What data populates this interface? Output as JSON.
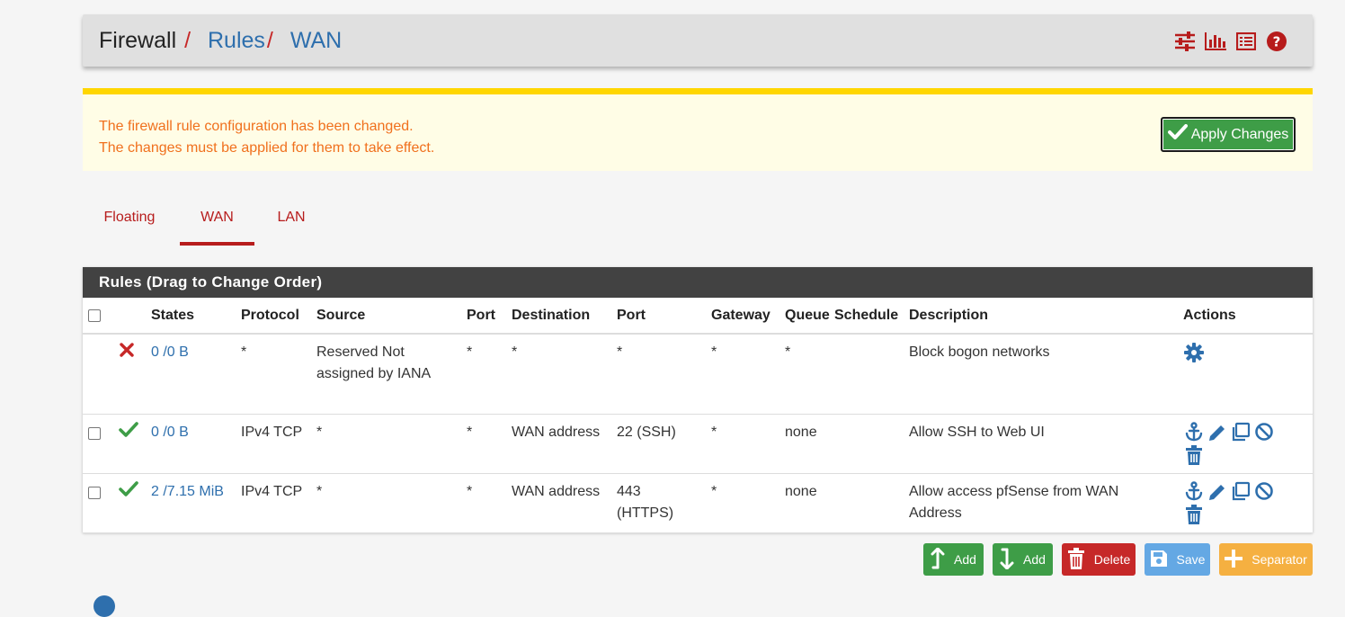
{
  "breadcrumb": {
    "root": "Firewall",
    "sep": "/",
    "rules": "Rules",
    "current": "WAN"
  },
  "header_icons": [
    "sliders-icon",
    "bar-chart-icon",
    "list-icon",
    "help-icon"
  ],
  "alert": {
    "line1": "The firewall rule configuration has been changed.",
    "line2": "The changes must be applied for them to take effect.",
    "apply_label": "Apply Changes"
  },
  "tabs": [
    {
      "label": "Floating",
      "active": false
    },
    {
      "label": "WAN",
      "active": true
    },
    {
      "label": "LAN",
      "active": false
    }
  ],
  "panel": {
    "title": "Rules (Drag to Change Order)",
    "columns": [
      "",
      "",
      "States",
      "Protocol",
      "Source",
      "Port",
      "Destination",
      "Port",
      "Gateway",
      "Queue",
      "Schedule",
      "Description",
      "Actions"
    ]
  },
  "rules": [
    {
      "status": "block",
      "states": "0 /0 B",
      "protocol": "*",
      "source": "Reserved Not assigned by IANA",
      "sport": "*",
      "destination": "*",
      "dport": "*",
      "gateway": "*",
      "queue": "*",
      "schedule": "",
      "description": "Block bogon networks"
    },
    {
      "status": "pass",
      "states": "0 /0 B",
      "protocol": "IPv4 TCP",
      "source": "*",
      "sport": "*",
      "destination": "WAN address",
      "dport": "22 (SSH)",
      "gateway": "*",
      "queue": "none",
      "schedule": "",
      "description": "Allow SSH to Web UI"
    },
    {
      "status": "pass",
      "states": "2 /7.15 MiB",
      "protocol": "IPv4 TCP",
      "source": "*",
      "sport": "*",
      "destination": "WAN address",
      "dport": "443 (HTTPS)",
      "gateway": "*",
      "queue": "none",
      "schedule": "",
      "description": "Allow access pfSense from WAN Address"
    }
  ],
  "buttons": {
    "add_top": "Add",
    "add_bottom": "Add",
    "delete": "Delete",
    "save": "Save",
    "separator": "Separator"
  },
  "colors": {
    "brand_red": "#b71c1c",
    "link_blue": "#2e6fad",
    "success_green": "#3e9d47",
    "alert_text": "#f0701d",
    "alert_bar": "#ffd600",
    "panel_head": "#424242"
  }
}
